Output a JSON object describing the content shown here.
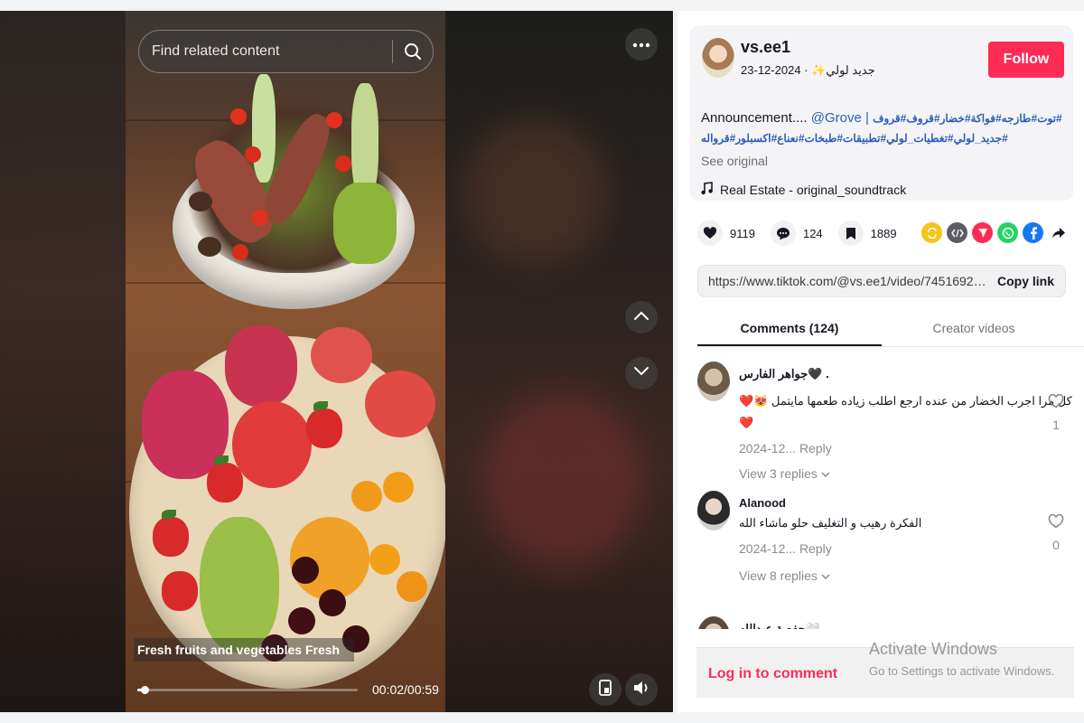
{
  "video": {
    "search_placeholder": "Find related content",
    "caption": "Fresh fruits and vegetables Fresh",
    "progress": 0.034,
    "time": "00:02/00:59"
  },
  "post": {
    "username": "vs.ee1",
    "subline": "جديد لولي✨ · 2024-12-23",
    "follow_label": "Follow",
    "description": "Announcement....",
    "mention": "@Grove |",
    "hashtags_line1": "توت#طازجه#فواكة#خضار#قروف#قروف#",
    "hashtags_line2": "جديد_لولي#تغطيات_لولي#تطبيقات#طبخات#نعناع#اكسبلور#قرواله#",
    "see_original": "See original",
    "sound": "Real Estate - original_soundtrack"
  },
  "stats": {
    "likes": "9119",
    "comments": "124",
    "saves": "1889"
  },
  "share": {
    "link": "https://www.tiktok.com/@vs.ee1/video/74516923053...",
    "copy_label": "Copy link"
  },
  "tabs": {
    "comments": "Comments (124)",
    "creator": "Creator videos"
  },
  "comments": [
    {
      "name": "جواهر الفارس🖤 .",
      "text": "كل مرا اجرب الخضار من عنده ارجع اطلب زياده طعمها مايتمل 😻❤️",
      "text2": "❤️",
      "meta": "2024-12... Reply",
      "replies": "View 3 replies",
      "likes": "1"
    },
    {
      "name": "Alanood",
      "text": "الفكرة رهيب و التغليف حلو ماشاء الله",
      "meta": "2024-12... Reply",
      "replies": "View 8 replies",
      "likes": "0"
    },
    {
      "name": "حفصة عبدالله🤍"
    }
  ],
  "login": {
    "label": "Log in to comment"
  },
  "watermark": {
    "title": "Activate Windows",
    "subtitle": "Go to Settings to activate Windows."
  },
  "colors": {
    "brand": "#fe2c55",
    "hashtag": "#2b5db9"
  },
  "icons": [
    "search-icon",
    "more-icon",
    "chevron-up-icon",
    "chevron-down-icon",
    "pip-icon",
    "volume-icon",
    "heart-icon",
    "comment-icon",
    "bookmark-icon",
    "music-note-icon",
    "repost-icon",
    "embed-icon",
    "send-icon",
    "whatsapp-icon",
    "facebook-icon",
    "share-arrow-icon"
  ]
}
